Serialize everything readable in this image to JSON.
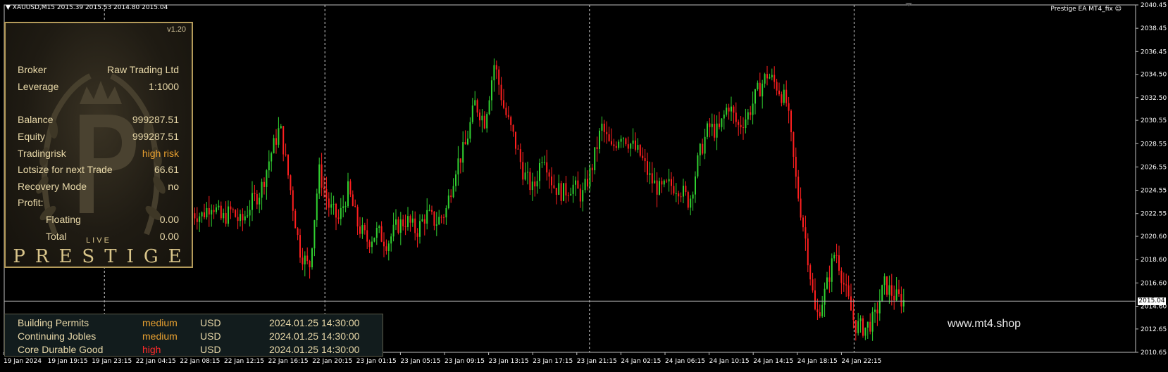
{
  "chart_header": "XAUUSD,M15  2015.39 2015.53 2014.80 2015.04",
  "ea_label": "Prestige EA MT4_fix",
  "watermark": "www.mt4.shop",
  "current_price": "2015.04",
  "colors": {
    "bull": "#31d131",
    "bear": "#ff1f1f",
    "background": "#000000",
    "grid": "#ffffff",
    "panel_border": "#b39a5a",
    "gold_text": "#e8d8a8"
  },
  "panel": {
    "version": "v1.20",
    "rows": [
      {
        "key": "Broker",
        "value": "Raw Trading Ltd"
      },
      {
        "key": "Leverage",
        "value": "1:1000"
      },
      {
        "key": "Balance",
        "value": "999287.51"
      },
      {
        "key": "Equity",
        "value": "999287.51"
      },
      {
        "key": "Tradingrisk",
        "value": "high risk"
      },
      {
        "key": "Lotsize for next Trade",
        "value": "66.61"
      },
      {
        "key": "Recovery Mode",
        "value": "no"
      },
      {
        "key": "Profit:",
        "value": ""
      },
      {
        "key": "Floating",
        "value": "0.00"
      },
      {
        "key": "Total",
        "value": "0.00"
      }
    ],
    "live_label": "LIVE",
    "brand": "PRESTIGE"
  },
  "news": [
    {
      "event": "Building Permits",
      "impact": "medium",
      "currency": "USD",
      "time": "2024.01.25 14:30:00"
    },
    {
      "event": "Continuing Jobles",
      "impact": "medium",
      "currency": "USD",
      "time": "2024.01.25 14:30:00"
    },
    {
      "event": "Core Durable Good",
      "impact": "high",
      "currency": "USD",
      "time": "2024.01.25 14:30:00"
    }
  ],
  "chart_data": {
    "type": "candlestick",
    "symbol": "XAUUSD",
    "timeframe": "M15",
    "ylim": [
      2010.65,
      2040.45
    ],
    "y_ticks": [
      "2040.45",
      "2038.45",
      "2036.45",
      "2034.50",
      "2032.50",
      "2030.55",
      "2028.55",
      "2026.55",
      "2024.55",
      "2022.55",
      "2020.60",
      "2018.60",
      "2016.60",
      "2014.60",
      "2012.65",
      "2010.65"
    ],
    "x_ticks": [
      "19 Jan 2024",
      "19 Jan 19:15",
      "19 Jan 23:15",
      "22 Jan 04:15",
      "22 Jan 08:15",
      "22 Jan 12:15",
      "22 Jan 16:15",
      "22 Jan 20:15",
      "23 Jan 01:15",
      "23 Jan 05:15",
      "23 Jan 09:15",
      "23 Jan 13:15",
      "23 Jan 17:15",
      "23 Jan 21:15",
      "24 Jan 02:15",
      "24 Jan 06:15",
      "24 Jan 10:15",
      "24 Jan 14:15",
      "24 Jan 18:15",
      "24 Jan 22:15"
    ],
    "session_separators": [
      "19 Jan 23:15",
      "22 Jan 20:15",
      "23 Jan 21:15",
      "24 Jan 22:15"
    ],
    "close_path": [
      2022.6,
      2022.4,
      2023.5,
      2022.0,
      2022.8,
      2021.7,
      2023.4,
      2024.5,
      2027.5,
      2030.0,
      2025.0,
      2019.5,
      2017.8,
      2026.2,
      2023.2,
      2022.0,
      2024.6,
      2021.5,
      2020.2,
      2021.0,
      2020.0,
      2021.5,
      2022.0,
      2021.0,
      2022.5,
      2021.8,
      2022.7,
      2026.5,
      2028.3,
      2032.0,
      2030.5,
      2035.5,
      2031.5,
      2029.0,
      2026.0,
      2024.5,
      2028.0,
      2025.0,
      2024.3,
      2025.0,
      2024.0,
      2026.5,
      2030.0,
      2028.0,
      2029.5,
      2028.5,
      2027.5,
      2025.5,
      2024.5,
      2025.0,
      2024.8,
      2023.5,
      2027.5,
      2030.0,
      2029.5,
      2032.0,
      2030.0,
      2031.0,
      2033.0,
      2034.5,
      2033.5,
      2032.0,
      2025.0,
      2020.0,
      2013.5,
      2016.0,
      2019.5,
      2016.0,
      2013.0,
      2012.7,
      2013.5,
      2016.5,
      2015.5,
      2015.04
    ]
  }
}
